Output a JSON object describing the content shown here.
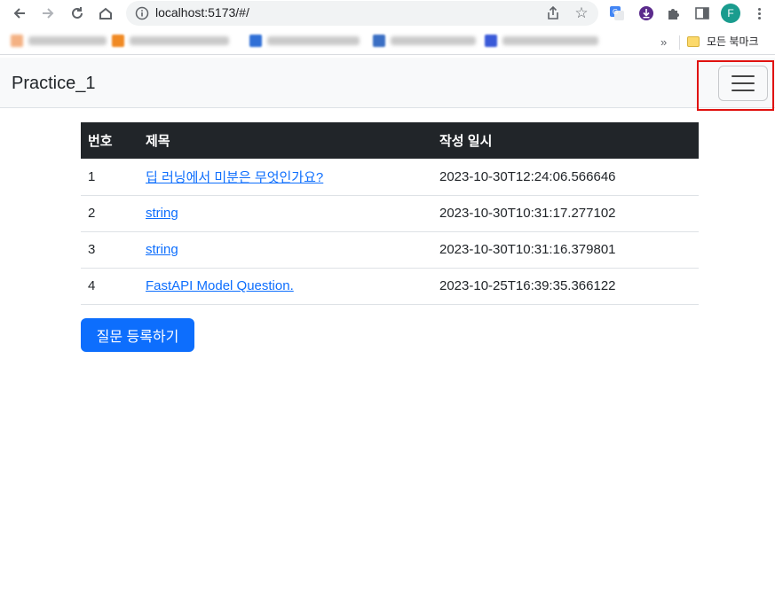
{
  "browser": {
    "url": "localhost:5173/#/",
    "profile_initial": "F",
    "bookmarks_overflow": "»",
    "bookmark_folder": "모든 북마크"
  },
  "navbar": {
    "brand": "Practice_1"
  },
  "table": {
    "headers": [
      "번호",
      "제목",
      "작성 일시"
    ],
    "rows": [
      {
        "num": "1",
        "title": "딥 러닝에서 미분은 무엇인가요?",
        "date": "2023-10-30T12:24:06.566646"
      },
      {
        "num": "2",
        "title": "string",
        "date": "2023-10-30T10:31:17.277102"
      },
      {
        "num": "3",
        "title": "string",
        "date": "2023-10-30T10:31:16.379801"
      },
      {
        "num": "4",
        "title": "FastAPI Model Question.",
        "date": "2023-10-25T16:39:35.366122"
      }
    ]
  },
  "actions": {
    "create_question": "질문 등록하기"
  },
  "colors": {
    "primary": "#0d6efd",
    "table_header": "#212529",
    "navbar_bg": "#f8f9fa",
    "highlight": "#e0120f"
  }
}
